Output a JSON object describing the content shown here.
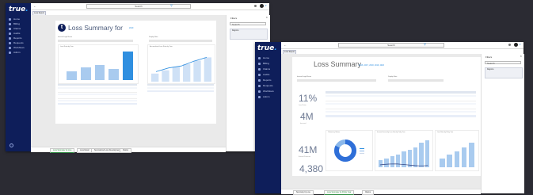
{
  "back_window": {
    "logo": "true",
    "nav_items": [
      "Home",
      "Billing",
      "Claims",
      "Audits",
      "Reports",
      "Requests",
      "Workflows",
      "Admin"
    ],
    "search_placeholder": "Search",
    "breadcrumb": "Loss Report",
    "report_title": "Loss Summary for",
    "report_subtitle": "2019",
    "label_left": "Insured Legal Name",
    "label_right": "Display Rate",
    "chart_left_title": "Loss Ratio by Year",
    "chart_right_title": "Accumulated Loss Ratio by Year",
    "filters_title": "Filters",
    "filters_search": "Search",
    "filter_card_title": "Regions",
    "tabs": [
      "Loss Summary by Line",
      "Loss Detail",
      "Summarized Loss Development",
      "Claims"
    ],
    "bar_values": [
      0.28,
      0.42,
      0.5,
      0.38,
      0.95
    ],
    "line_values": [
      0.35,
      0.48,
      0.55,
      0.72,
      0.85
    ],
    "right_bar_values": [
      0.3,
      0.42,
      0.55,
      0.65,
      0.78,
      0.9
    ]
  },
  "front_window": {
    "logo": "true",
    "nav_items": [
      "Home",
      "Billing",
      "Claims",
      "Audits",
      "Reports",
      "Requests",
      "Workflows",
      "Admin"
    ],
    "search_placeholder": "Search",
    "breadcrumb": "Loss Report",
    "report_title": "Loss Summary",
    "report_subtitle": "2016, 2017, 2018, 2019, 2020",
    "label_left": "Insured Legal Name",
    "label_right": "Display Rate",
    "kpis": [
      {
        "value": "11%",
        "label": "Loss Ratio"
      },
      {
        "value": "4M",
        "label": "Incurred"
      },
      {
        "value": "41M",
        "label": "Earned Premium"
      },
      {
        "value": "4,380",
        "label": "Claim Count"
      }
    ],
    "table_headers": [
      "Policy Year",
      "Open",
      "Closed",
      "Subrogation",
      "# Paid",
      "Indemnity",
      "Total",
      "Reserves",
      "Incurred",
      "Loss Ratio",
      "Earned Prem",
      "Frequency"
    ],
    "donut_title": "Claims by Status",
    "chart_mid_title": "Incurred Losses by Loss Date by Policy Year",
    "chart_right_title": "Loss Ratio by Policy Year",
    "filters_title": "Filters",
    "filters_search": "Search",
    "filter_card_title": "Regions",
    "tabs": [
      "Summary by Line",
      "Loss Summary by Policy Year",
      "Claims"
    ],
    "bar_values": [
      0.25,
      0.3,
      0.38,
      0.45,
      0.55,
      0.62,
      0.7,
      0.85,
      0.95
    ],
    "right_bar_values": [
      0.3,
      0.45,
      0.55,
      0.7,
      0.85
    ],
    "donut_fraction": 0.82,
    "accent": "#2f8fe0",
    "nav_bg": "#0e1e5a"
  }
}
